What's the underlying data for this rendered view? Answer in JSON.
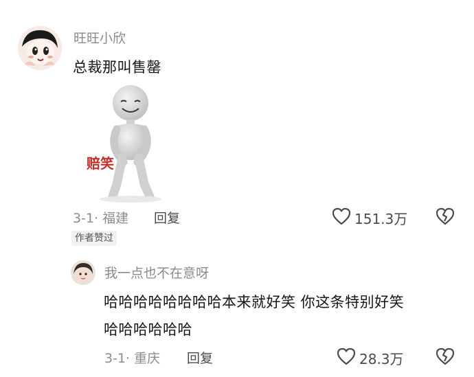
{
  "comments": [
    {
      "username": "旺旺小欣",
      "text": "总裁那叫售罄",
      "sticker_caption": "赔笑",
      "date": "3-1",
      "location": "福建",
      "reply_label": "回复",
      "likes": "151.3万",
      "badge": "作者赞过",
      "avatar_icon": "cartoon-girl-icon"
    },
    {
      "username": "我一点也不在意呀",
      "text_line1": "哈哈哈哈哈哈哈哈本来就好笑 你这条特别好笑",
      "text_line2": "哈哈哈哈哈哈",
      "date": "3-1",
      "location": "重庆",
      "reply_label": "回复",
      "likes": "28.3万",
      "avatar_icon": "photo-avatar-icon"
    }
  ],
  "icons": {
    "like": "heart-icon",
    "dislike": "broken-heart-icon"
  }
}
